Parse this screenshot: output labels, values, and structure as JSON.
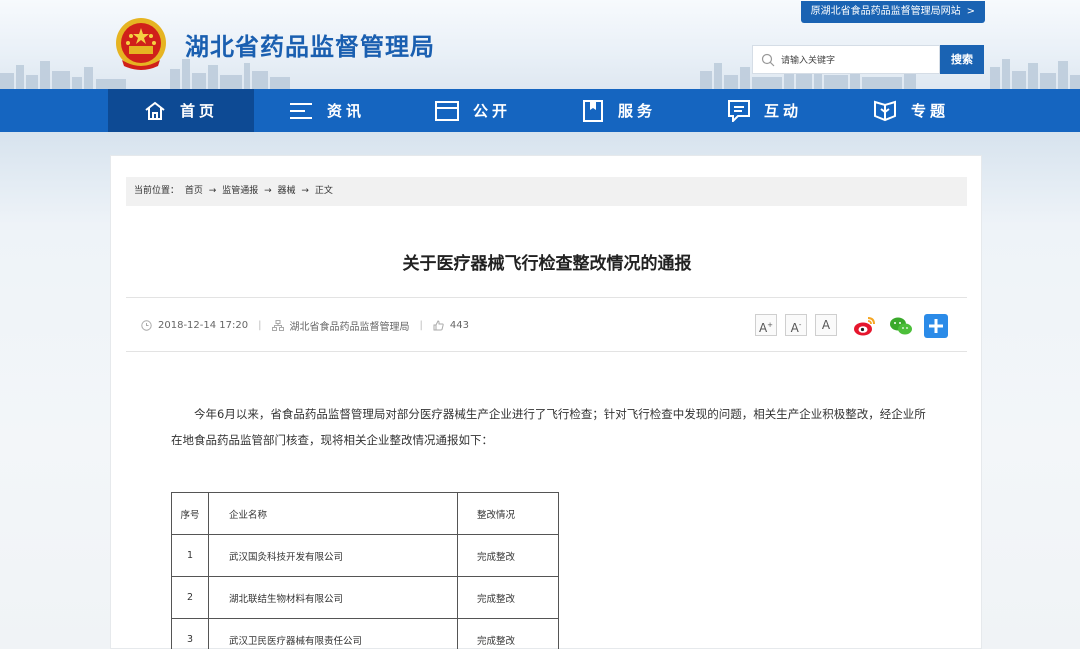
{
  "header": {
    "site_title": "湖北省药品监督管理局",
    "old_site_link": "原湖北省食品药品监督管理局网站",
    "old_site_chevron": ">",
    "search_placeholder": "请输入关键字",
    "search_button": "搜索"
  },
  "nav": {
    "items": [
      {
        "label": "首页",
        "icon": "home-icon",
        "active": true
      },
      {
        "label": "资讯",
        "icon": "list-icon"
      },
      {
        "label": "公开",
        "icon": "folder-icon"
      },
      {
        "label": "服务",
        "icon": "bookmark-icon"
      },
      {
        "label": "互动",
        "icon": "chat-icon"
      },
      {
        "label": "专题",
        "icon": "shield-book-icon"
      }
    ]
  },
  "breadcrumb": {
    "prefix": "当前位置：",
    "items": [
      "首页",
      "监管通报",
      "器械",
      "正文"
    ],
    "separator": "→"
  },
  "article": {
    "title": "关于医疗器械飞行检查整改情况的通报",
    "date": "2018-12-14 17:20",
    "source": "湖北省食品药品监督管理局",
    "views": "443",
    "font_sizes": [
      "A",
      "A",
      "A"
    ],
    "paragraph": "今年6月以来，省食品药品监督管理局对部分医疗器械生产企业进行了飞行检查；针对飞行检查中发现的问题，相关生产企业积极整改，经企业所在地食品药品监管部门核查，现将相关企业整改情况通报如下："
  },
  "table": {
    "headers": [
      "序号",
      "企业名称",
      "整改情况"
    ],
    "rows": [
      [
        "1",
        "武汉国灸科技开发有限公司",
        "完成整改"
      ],
      [
        "2",
        "湖北联结生物材料有限公司",
        "完成整改"
      ],
      [
        "3",
        "武汉卫民医疗器械有限责任公司",
        "完成整改"
      ]
    ]
  },
  "colors": {
    "brand_blue": "#1565c0",
    "nav_active": "#0d4a94",
    "title_blue": "#1a5fb0"
  }
}
